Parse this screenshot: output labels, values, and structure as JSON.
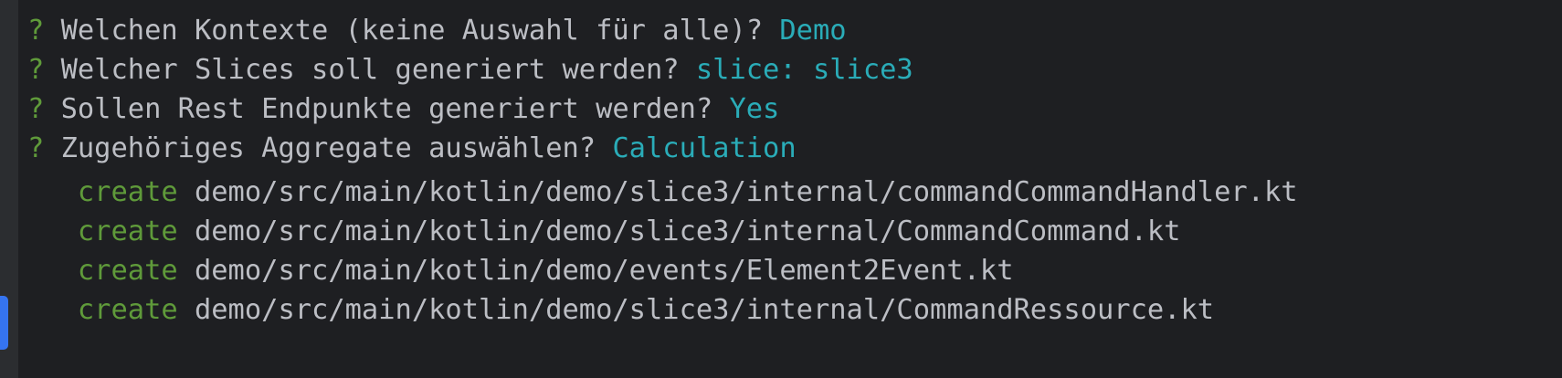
{
  "colors": {
    "background": "#1e1f22",
    "text": "#bcbec4",
    "prompt_mark": "#5f9a3a",
    "answer": "#2aacb8",
    "create": "#5f9a3a",
    "active_tab": "#3574f0"
  },
  "prompts": [
    {
      "mark": "?",
      "question": "Welchen Kontexte (keine Auswahl für alle)?",
      "answer": "Demo"
    },
    {
      "mark": "?",
      "question": "Welcher Slices soll generiert werden?",
      "answer": "slice: slice3"
    },
    {
      "mark": "?",
      "question": "Sollen Rest Endpunkte generiert werden?",
      "answer": "Yes"
    },
    {
      "mark": "?",
      "question": "Zugehöriges Aggregate auswählen?",
      "answer": "Calculation"
    }
  ],
  "output": [
    {
      "action": "create",
      "path": "demo/src/main/kotlin/demo/slice3/internal/commandCommandHandler.kt"
    },
    {
      "action": "create",
      "path": "demo/src/main/kotlin/demo/slice3/internal/CommandCommand.kt"
    },
    {
      "action": "create",
      "path": "demo/src/main/kotlin/demo/events/Element2Event.kt"
    },
    {
      "action": "create",
      "path": "demo/src/main/kotlin/demo/slice3/internal/CommandRessource.kt"
    }
  ]
}
